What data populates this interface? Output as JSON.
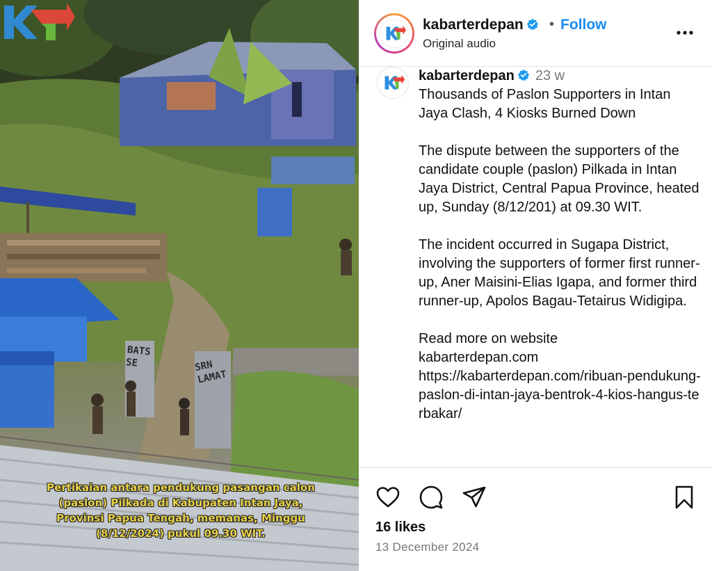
{
  "media": {
    "caption_lines": [
      "Pertikaian antara pendukung pasangan calon",
      "(paslon) Pilkada di Kabupaten Intan Jaya,",
      "Provinsi Papua Tengah, memanas, Minggu",
      "(8/12/2024) pukul 09.30 WIT."
    ],
    "sign_left": "BATS SE",
    "sign_right": "SRN LAMAT"
  },
  "header": {
    "username": "kabarterdepan",
    "dot": "•",
    "follow_label": "Follow",
    "subtitle": "Original audio",
    "more_icon": "more-horizontal-icon"
  },
  "post": {
    "username": "kabarterdepan",
    "age": "23 w",
    "paragraphs": [
      "Thousands of Paslon Supporters in Intan Jaya Clash, 4 Kiosks Burned Down",
      "The dispute between the supporters of the candidate couple (paslon) Pilkada in Intan Jaya District, Central Papua Province, heated up, Sunday (8/12/201) at 09.30 WIT.",
      "The incident occurred in Sugapa District, involving the supporters of former first runner-up, Aner Maisini-Elias Igapa, and former third runner-up, Apolos Bagau-Tetairus Widigipa."
    ],
    "read_more": "Read more on website",
    "site": "kabarterdepan.com",
    "url": "https://kabarterdepan.com/ribuan-pendukung-paslon-di-intan-jaya-bentrok-4-kios-hangus-terbakar/"
  },
  "footer": {
    "likes": "16 likes",
    "date": "13 December 2024",
    "icons": [
      "heart-icon",
      "comment-icon",
      "share-icon",
      "bookmark-icon"
    ]
  },
  "colors": {
    "follow": "#1a8cf0",
    "verified": "#1d9bf0",
    "caption": "#e8d24a"
  }
}
